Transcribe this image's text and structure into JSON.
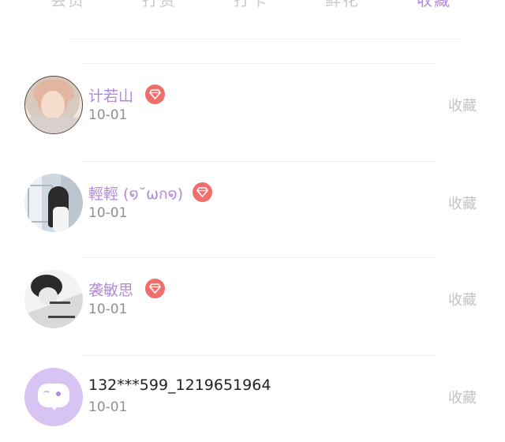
{
  "tabs": [
    {
      "label": "会员",
      "active": false
    },
    {
      "label": "打赏",
      "active": false
    },
    {
      "label": "打卡",
      "active": false
    },
    {
      "label": "鲜花",
      "active": false
    },
    {
      "label": "收藏",
      "active": true
    }
  ],
  "list": [
    {
      "name": "计若山",
      "date": "10-01",
      "vip": true,
      "action": "收藏",
      "avatar": "user-photo-avatar"
    },
    {
      "name": "輕輕 (໑˘ωก໑)",
      "date": "10-01",
      "vip": true,
      "action": "收藏",
      "avatar": "user-photo-avatar"
    },
    {
      "name": "袭敏思",
      "date": "10-01",
      "vip": true,
      "action": "收藏",
      "avatar": "user-photo-avatar"
    },
    {
      "name": "132***599_1219651964",
      "date": "10-01",
      "vip": false,
      "action": "收藏",
      "avatar": "default-chat-bubble-avatar"
    }
  ],
  "colors": {
    "accent": "#b38ae0",
    "vip_badge": "#ef6f6c",
    "muted_text": "#c2c2c8",
    "date_text": "#8f8f95"
  }
}
